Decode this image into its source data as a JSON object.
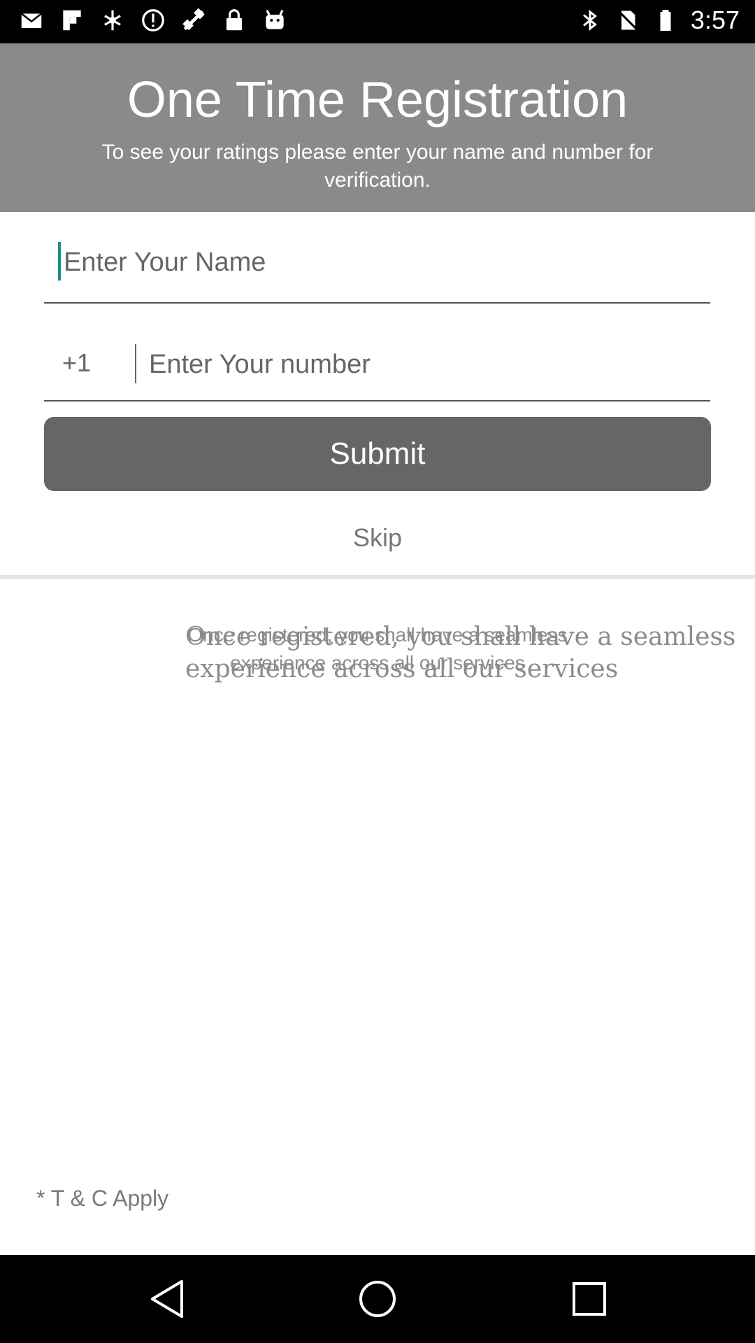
{
  "status_bar": {
    "time": "3:57",
    "left_icons": [
      "mail-icon",
      "flipboard-icon",
      "satellite-icon",
      "alert-icon",
      "fake-gps-icon",
      "lock-icon",
      "android-icon"
    ],
    "right_icons": [
      "bluetooth-icon",
      "no-sim-icon",
      "battery-icon"
    ]
  },
  "header": {
    "title": "One Time Registration",
    "subtitle": "To see your ratings please enter your name and number for verification.",
    "background": "#8a8a8a"
  },
  "form": {
    "name_placeholder": "Enter Your Name",
    "name_value": "",
    "country_code": "+1",
    "number_placeholder": "Enter Your number",
    "number_value": "",
    "submit_label": "Submit",
    "submit_color": "#666666",
    "cursor_color": "#1a8f8a",
    "skip_label": "Skip"
  },
  "info": {
    "message_small": "Once registered, you shall have a seamless experience across all our services",
    "message_large_line1": "Once registered, you shall have a seamless",
    "message_large_line2": "experience across all our services"
  },
  "footer": {
    "terms": "* T & C Apply"
  },
  "nav": {
    "back": "back-icon",
    "home": "home-icon",
    "recents": "recents-icon"
  }
}
